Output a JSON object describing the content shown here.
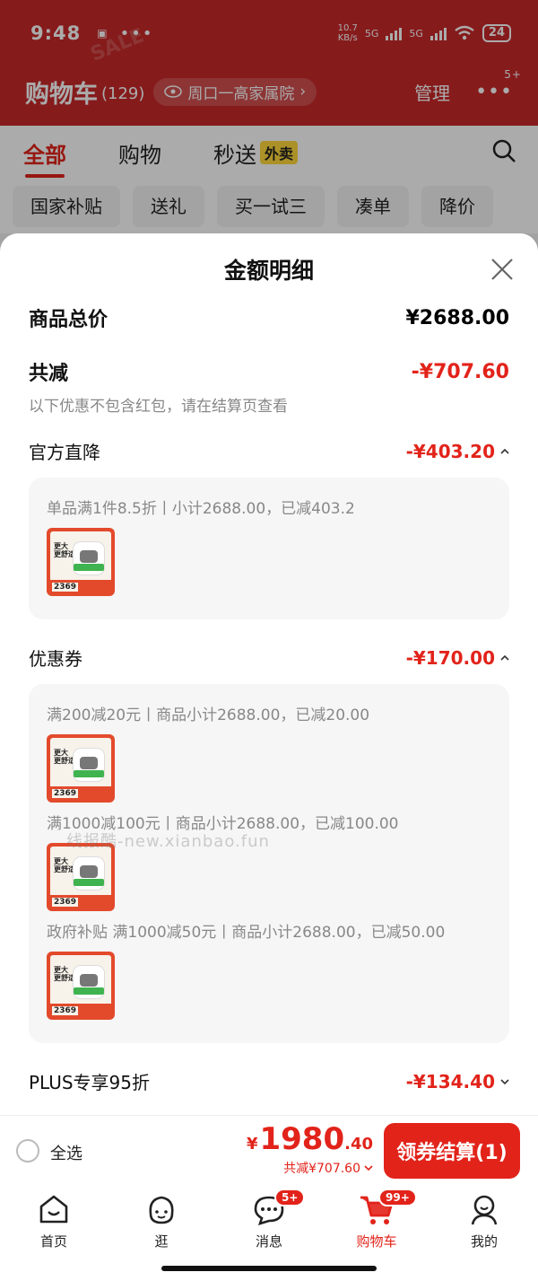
{
  "status_bar": {
    "time": "9:48",
    "net_speed_top": "10.7",
    "net_speed_bottom": "KB/s",
    "sig1": "5G",
    "sig2": "5G",
    "battery": "24"
  },
  "header": {
    "deco": "SALE",
    "title": "购物车",
    "count": "(129)",
    "address": "周口一高家属院",
    "manage": "管理",
    "more_badge": "5+"
  },
  "tabs": [
    {
      "label": "全部"
    },
    {
      "label": "购物"
    },
    {
      "label": "秒送"
    }
  ],
  "takeout_tag": "外卖",
  "chips": [
    "国家补贴",
    "送礼",
    "买一试三",
    "凑单",
    "降价"
  ],
  "sheet": {
    "title": "金额明细",
    "total_label": "商品总价",
    "total_value": "¥2688.00",
    "discount_label": "共减",
    "discount_value": "-¥707.60",
    "hint": "以下优惠不包含红包，请在结算页查看",
    "official": {
      "label": "官方直降",
      "value": "-¥403.20"
    },
    "official_rule": "单品满1件8.5折丨小计2688.00，已减403.2",
    "coupon": {
      "label": "优惠券",
      "value": "-¥170.00"
    },
    "coupon_rules": [
      "满200减20元丨商品小计2688.00，已减20.00",
      "满1000减100元丨商品小计2688.00，已减100.00",
      "政府补贴 满1000减50元丨商品小计2688.00，已减50.00"
    ],
    "plus": {
      "label": "PLUS专享95折",
      "value": "-¥134.40"
    },
    "thumb": {
      "line1": "更大",
      "line2": "更舒适",
      "price": "2369"
    },
    "watermark": "线报酷-new.xianbao.fun"
  },
  "checkout": {
    "select_all": "全选",
    "currency": "¥",
    "price_int": "1980",
    "price_dec": ".40",
    "saved": "共减¥707.60",
    "button": "领券结算(1)"
  },
  "nav": {
    "items": [
      {
        "label": "首页",
        "icon": "home-icon"
      },
      {
        "label": "逛",
        "icon": "browse-icon"
      },
      {
        "label": "消息",
        "icon": "message-icon"
      },
      {
        "label": "购物车",
        "icon": "cart-icon"
      },
      {
        "label": "我的",
        "icon": "profile-icon"
      }
    ],
    "msg_badge": "5+",
    "cart_badge": "99+"
  },
  "colors": {
    "accent": "#e2231a",
    "header_bg": "#c8292a"
  }
}
